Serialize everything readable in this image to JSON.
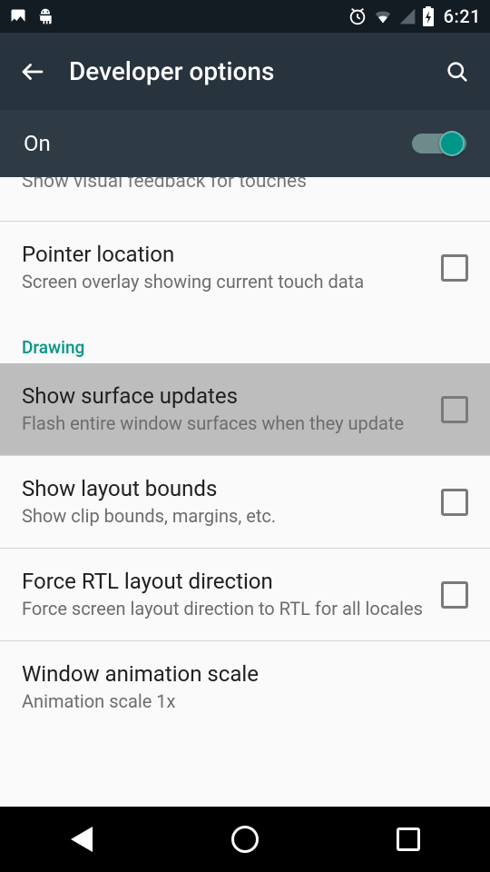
{
  "status_bar": {
    "clock": "6:21"
  },
  "app_bar": {
    "title": "Developer options"
  },
  "master_switch": {
    "label": "On",
    "on": true
  },
  "colors": {
    "accent": "#009688"
  },
  "clipped_row_text": "Show visual feedback for touches",
  "section_drawing": "Drawing",
  "items": {
    "pointer_location": {
      "title": "Pointer location",
      "sub": "Screen overlay showing current touch data",
      "checked": false
    },
    "surface_updates": {
      "title": "Show surface updates",
      "sub": "Flash entire window surfaces when they update",
      "checked": false
    },
    "layout_bounds": {
      "title": "Show layout bounds",
      "sub": "Show clip bounds, margins, etc.",
      "checked": false
    },
    "force_rtl": {
      "title": "Force RTL layout direction",
      "sub": "Force screen layout direction to RTL for all locales",
      "checked": false
    },
    "window_anim": {
      "title": "Window animation scale",
      "sub": "Animation scale 1x"
    }
  }
}
